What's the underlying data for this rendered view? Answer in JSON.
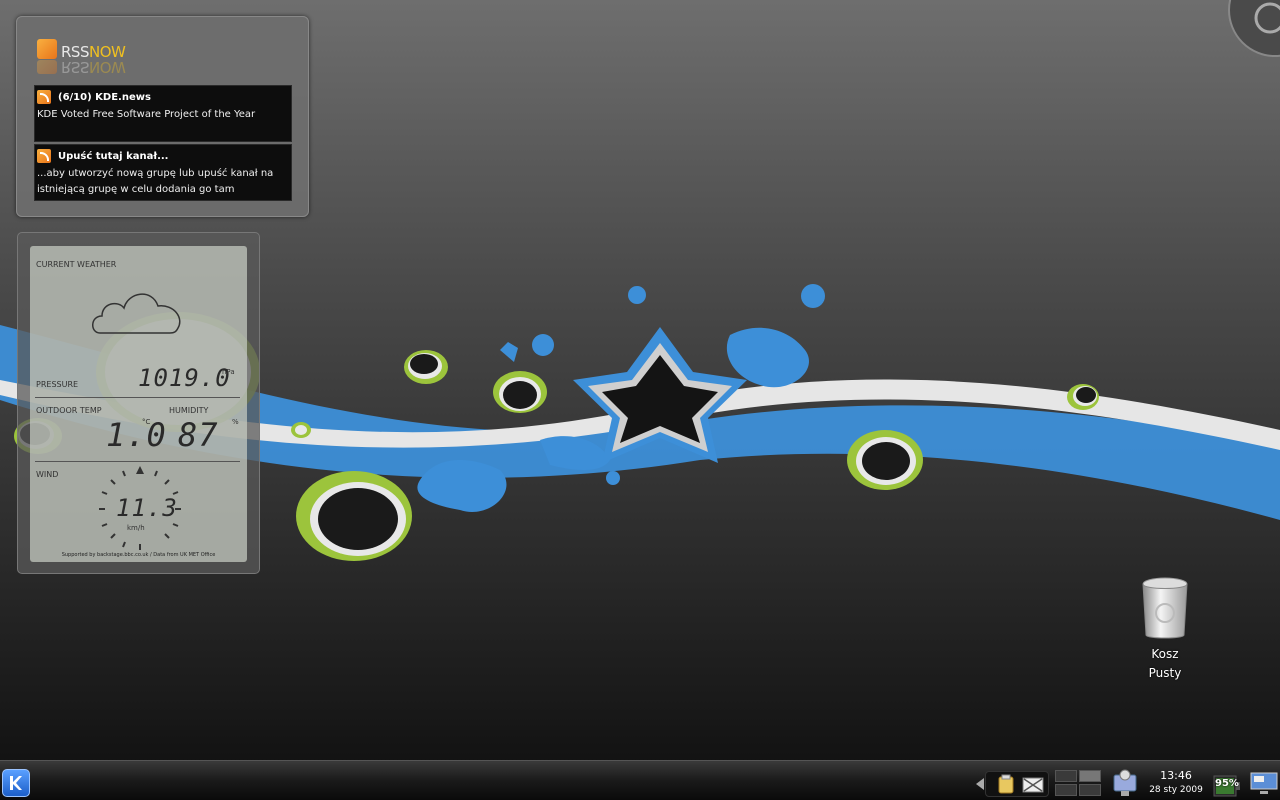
{
  "rss": {
    "brand_rss": "RSS",
    "brand_now": "NOW",
    "items": [
      {
        "title": "(6/10) KDE.news",
        "body": "KDE Voted Free Software Project of the Year"
      },
      {
        "title": "Upuść tutaj kanał...",
        "body_line1": "...aby utworzyć nową grupę lub upuść kanał na",
        "body_line2": "istniejącą grupę w celu dodania go tam"
      }
    ]
  },
  "weather": {
    "current_label": "CURRENT WEATHER",
    "pressure_label": "PRESSURE",
    "pressure_value": "1019.0",
    "pressure_unit": "hPa",
    "outdoor_label": "OUTDOOR TEMP",
    "temp_value": "1.0",
    "temp_unit": "°C",
    "humidity_label": "HUMIDITY",
    "humidity_value": "87",
    "humidity_unit": "%",
    "wind_label": "WIND",
    "wind_value": "11.3",
    "wind_unit": "km/h",
    "credit": "Supported by backstage.bbc.co.uk / Data from UK MET Office"
  },
  "trash": {
    "label_line1": "Kosz",
    "label_line2": "Pusty"
  },
  "clock": {
    "time": "13:46",
    "date": "28 sty 2009"
  },
  "battery": {
    "percent": "95%"
  },
  "colors": {
    "accent_blue": "#3d8fd8",
    "accent_green": "#9cc43c",
    "panel": "#6e6e6e"
  }
}
